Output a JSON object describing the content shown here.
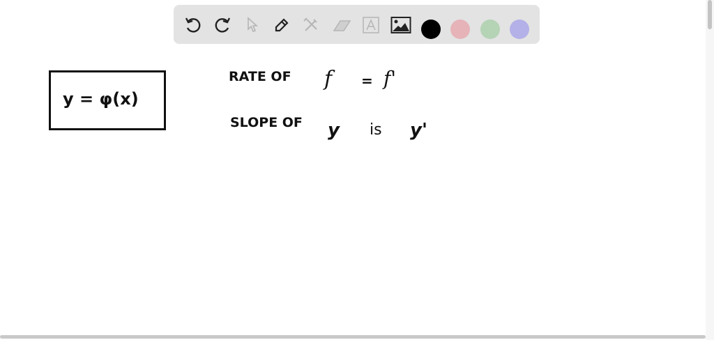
{
  "toolbar": {
    "tools": [
      "undo-icon",
      "redo-icon",
      "select-icon",
      "pen-icon",
      "tools-icon",
      "eraser-icon",
      "text-icon",
      "image-icon"
    ],
    "colors": {
      "black": "#000000",
      "pink": "#e6b3b8",
      "green": "#b5d3b5",
      "purple": "#b4b0e8"
    }
  },
  "canvas": {
    "boxed_equation": "y = φ(x)",
    "line1": {
      "label": "RATE OF",
      "var": "f",
      "eq": "=",
      "rhs": "f'"
    },
    "line2": {
      "label": "SLOPE OF",
      "var": "y",
      "is": "is",
      "rhs": "y'"
    }
  }
}
